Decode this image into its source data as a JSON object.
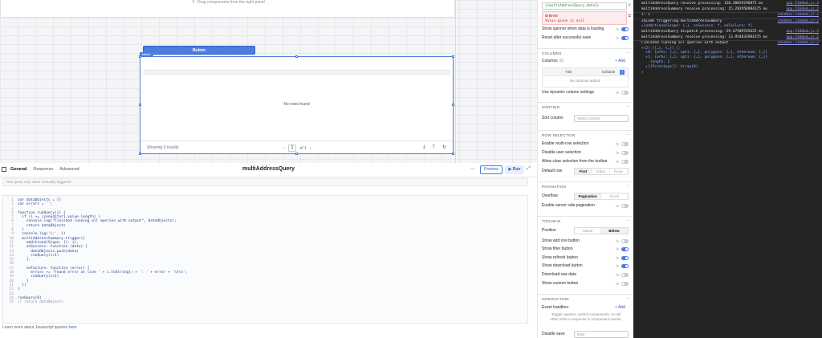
{
  "canvas": {
    "drag_hint": "Drag components from the right panel",
    "button_label": "Button",
    "table_tag": "table1",
    "no_rows": "No rows found",
    "showing": "Showing 0 results",
    "page_current": "1",
    "page_total": "of 1"
  },
  "editor": {
    "tabs": [
      "General",
      "Response",
      "Advanced"
    ],
    "title": "multiAddressQuery",
    "preview_label": "Preview",
    "run_label": "▶ Run",
    "trigger": "Run query only when manually triggered",
    "learn_prefix": "Learn more about Javascript queries ",
    "learn_link": "here",
    "code_lines": [
      {
        "n": "1",
        "t": "var dataObjects = []"
      },
      {
        "n": "2",
        "t": "var errors = '';"
      },
      {
        "n": "3",
        "t": ""
      },
      {
        "n": "4",
        "t": "function runQuery(i) {"
      },
      {
        "n": "5",
        "t": "  if (i >= jsonEditor1.value.length) {"
      },
      {
        "n": "6",
        "t": "    console.log(\"Finished running all queries with output\", dataObjects);"
      },
      {
        "n": "7",
        "t": "    return dataObjects"
      },
      {
        "n": "8",
        "t": "  }"
      },
      {
        "n": "9",
        "t": "  console.log('i:', i)"
      },
      {
        "n": "10",
        "t": "  multiAddressSummary.trigger({"
      },
      {
        "n": "11",
        "t": "    additionalScope: {i: i},"
      },
      {
        "n": "12",
        "t": "    onSuccess: function (data) {"
      },
      {
        "n": "13",
        "t": "      dataObjects.push(data)"
      },
      {
        "n": "14",
        "t": "      runQuery(i+1)"
      },
      {
        "n": "15",
        "t": "    },"
      },
      {
        "n": "16",
        "t": ""
      },
      {
        "n": "17",
        "t": "    onFailure: function (error) {"
      },
      {
        "n": "18",
        "t": "      errors += 'Found error at line ' + i.toString() + ': ' + error + '\\n\\n';"
      },
      {
        "n": "19",
        "t": "      runQuery(i+1)"
      },
      {
        "n": "20",
        "t": "    }"
      },
      {
        "n": "21",
        "t": "  })"
      },
      {
        "n": "22",
        "t": "}"
      },
      {
        "n": "23",
        "t": ""
      },
      {
        "n": "24",
        "t": "runQuery(0)"
      },
      {
        "n": "25",
        "t": "// return dataObjects"
      }
    ]
  },
  "sidebar": {
    "data_value": "{{multiAddressQuery.data}}",
    "error_title": "Error",
    "error_msg": "Value given is null",
    "show_spinner": "Show spinner when data is loading",
    "reset_after": "Reset after successful save",
    "columns_section": "COLUMNS",
    "columns_label": "Columns",
    "columns_count": "(0)",
    "add_label": "+ Add",
    "col_title": "Title",
    "col_editable": "Editable",
    "no_columns": "No columns added.",
    "dynamic_cols": "Use dynamic column settings",
    "sorting_section": "SORTING",
    "sort_column": "Sort column",
    "sort_placeholder": "Select column",
    "row_selection_section": "ROW SELECTION",
    "multi_row": "Enable multi-row selection",
    "disable_user": "Disable user selection",
    "allow_clear": "Allow clear selection from the toolbar",
    "default_row": "Default row",
    "default_opts": [
      "First",
      "Index",
      "None"
    ],
    "pagination_section": "PAGINATION",
    "overflow": "Overflow",
    "overflow_opts": [
      "Pagination",
      "Scroll"
    ],
    "server_side": "Enable server side pagination",
    "toolbar_section": "TOOLBAR",
    "position": "Position",
    "position_opts": [
      "Above",
      "Below"
    ],
    "add_row": "Show add row button",
    "filter": "Show filter button",
    "refresh": "Show refresh button",
    "download": "Show download button",
    "raw": "Download raw data",
    "custom": "Show custom button",
    "interaction_section": "INTERACTION",
    "event_handlers": "Event handlers",
    "event_hint": "Trigger queries, control components, or call other APIs in response to component events.",
    "disable_save": "Disable save",
    "disable_save_val": "false"
  },
  "console": {
    "lines": [
      {
        "t": "multiAddressQuery receive processing: 120.30029296875 ms",
        "src": "app.5160ad…js:2"
      },
      {
        "t": "multiAddressSummary receive processing: 15.282958984375 ms",
        "src": "app.5160ad…js:2"
      },
      {
        "t": "i: 1",
        "src": "sandbox.5160ad…js:2"
      },
      {
        "t": "JSCode triggering multiAddressSummary",
        "src": "sandbox.5160ad…js:2"
      },
      {
        "t": "▸{additionalScope: {…}, onSuccess: f, onFailure: f}",
        "src": ""
      },
      {
        "t": "multiAddressQuery dispatch processing: 29.47509765625 ms",
        "src": "app.5160ad…js:2"
      },
      {
        "t": "multiAddressSummary receive processing: 13.954833984375 ms",
        "src": "app.5160ad…js:2"
      },
      {
        "t": "Finished running all queries with output",
        "src": "sandbox.5160ad…js:2"
      },
      {
        "t": "▾(2) [{…}, {…}] ⓘ",
        "src": ""
      },
      {
        "t": "  ▸0: {urbs: {…}, opti: {…}, polygons: {…}, ethereum: {…}}",
        "src": ""
      },
      {
        "t": "  ▸1: {urbs: {…}, opti: {…}, polygons: {…}, ethereum: {…}}",
        "src": ""
      },
      {
        "t": "    length: 2",
        "src": ""
      },
      {
        "t": "  ▸[[Prototype]]: Array(0)",
        "src": ""
      },
      {
        "t": "›",
        "src": ""
      }
    ]
  }
}
